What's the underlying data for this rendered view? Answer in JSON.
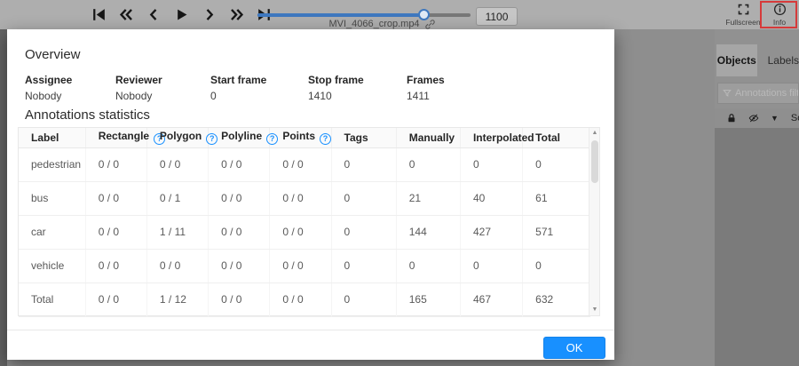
{
  "toolbar": {
    "filename": "MVI_4066_crop.mp4",
    "frame_value": "1100",
    "fullscreen_label": "Fullscreen",
    "info_label": "Info",
    "slider_percent": 78
  },
  "sidebar": {
    "tabs": [
      {
        "label": "Objects"
      },
      {
        "label": "Labels"
      }
    ],
    "filter_placeholder": "Annotations filte",
    "sort_label": "So"
  },
  "modal": {
    "overview_title": "Overview",
    "meta": [
      {
        "label": "Assignee",
        "value": "Nobody"
      },
      {
        "label": "Reviewer",
        "value": "Nobody"
      },
      {
        "label": "Start frame",
        "value": "0"
      },
      {
        "label": "Stop frame",
        "value": "1410"
      },
      {
        "label": "Frames",
        "value": "1411"
      }
    ],
    "stats_title": "Annotations statistics",
    "table": {
      "headers": [
        "Label",
        "Rectangle",
        "Polygon",
        "Polyline",
        "Points",
        "Tags",
        "Manually",
        "Interpolated",
        "Total"
      ],
      "question_mark": "?",
      "rows": [
        {
          "label": "pedestrian",
          "cells": [
            "0 / 0",
            "0 / 0",
            "0 / 0",
            "0 / 0",
            "0",
            "0",
            "0",
            "0"
          ]
        },
        {
          "label": "bus",
          "cells": [
            "0 / 0",
            "0 / 1",
            "0 / 0",
            "0 / 0",
            "0",
            "21",
            "40",
            "61"
          ]
        },
        {
          "label": "car",
          "cells": [
            "0 / 0",
            "1 / 11",
            "0 / 0",
            "0 / 0",
            "0",
            "144",
            "427",
            "571"
          ]
        },
        {
          "label": "vehicle",
          "cells": [
            "0 / 0",
            "0 / 0",
            "0 / 0",
            "0 / 0",
            "0",
            "0",
            "0",
            "0"
          ]
        },
        {
          "label": "Total",
          "cells": [
            "0 / 0",
            "1 / 12",
            "0 / 0",
            "0 / 0",
            "0",
            "165",
            "467",
            "632"
          ]
        }
      ]
    },
    "ok_label": "OK"
  },
  "colors": {
    "accent": "#1890ff",
    "slider_blue": "#3e78bf",
    "highlight_red": "#d63a3a"
  }
}
